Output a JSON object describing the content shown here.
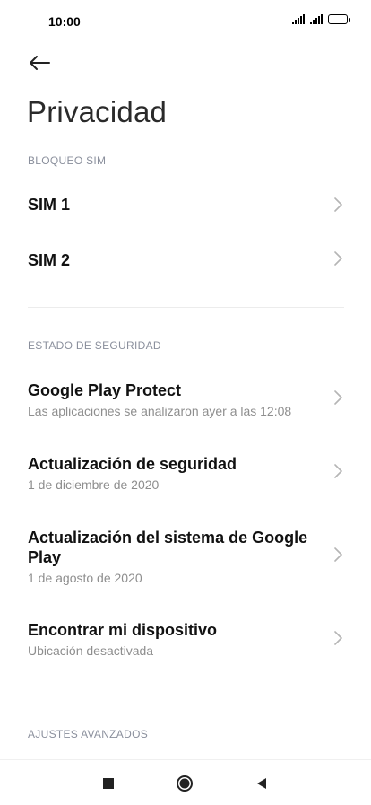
{
  "status_bar": {
    "time": "10:00"
  },
  "header": {
    "title": "Privacidad"
  },
  "sections": {
    "sim_lock": {
      "header": "BLOQUEO SIM",
      "items": [
        {
          "title": "SIM 1"
        },
        {
          "title": "SIM 2"
        }
      ]
    },
    "security": {
      "header": "ESTADO DE SEGURIDAD",
      "items": [
        {
          "title": "Google Play Protect",
          "subtitle": "Las aplicaciones se analizaron ayer a las 12:08"
        },
        {
          "title": "Actualización de seguridad",
          "subtitle": "1 de diciembre de 2020"
        },
        {
          "title": "Actualización del sistema de Google",
          "title_line2": "Play",
          "subtitle": "1 de agosto de 2020"
        },
        {
          "title": "Encontrar mi dispositivo",
          "subtitle": "Ubicación desactivada"
        }
      ]
    },
    "advanced": {
      "header": "AJUSTES AVANZADOS"
    }
  },
  "colors": {
    "section_header": "#8a8f9c",
    "subtitle": "#8e8e8e",
    "chevron": "#b5b5b5"
  }
}
